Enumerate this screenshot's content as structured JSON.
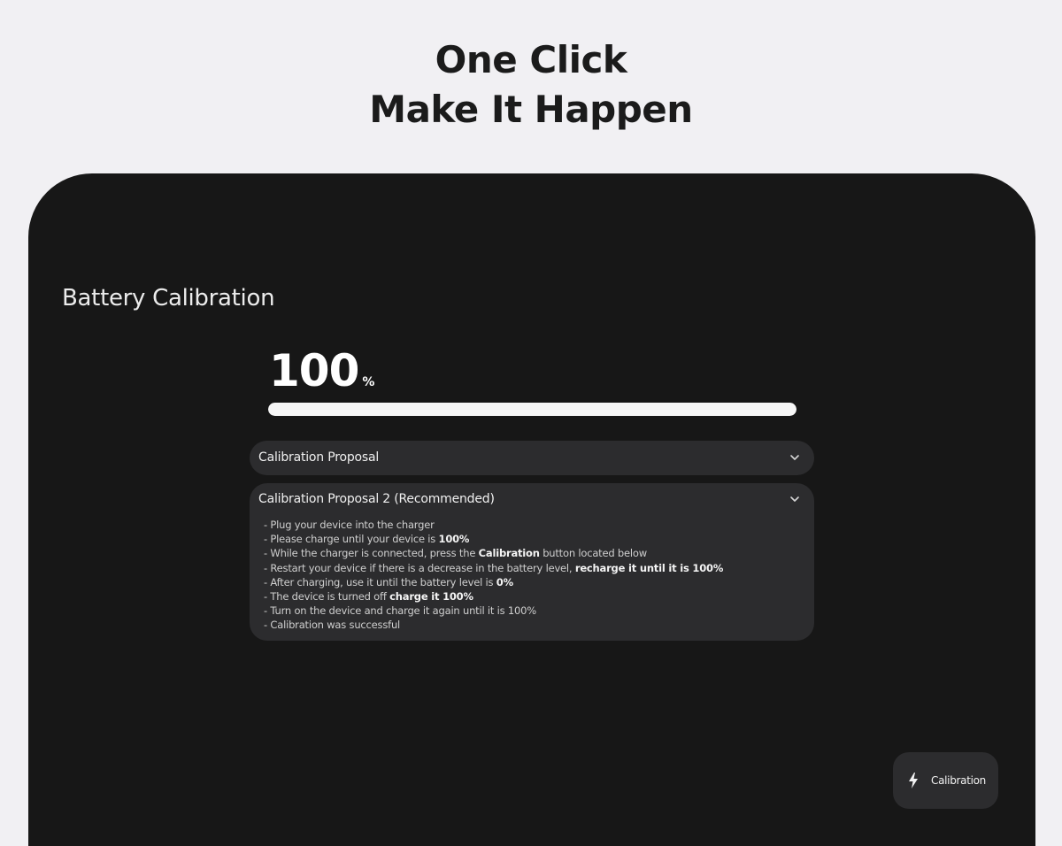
{
  "hero": {
    "line1": "One Click",
    "line2": "Make It Happen"
  },
  "app": {
    "title": "Battery Calibration"
  },
  "battery": {
    "level_value": "100",
    "level_unit": "%",
    "progress_percent": 100
  },
  "proposals": [
    {
      "title": "Calibration Proposal",
      "expanded": false
    },
    {
      "title": "Calibration Proposal 2 (Recommended)",
      "expanded": true,
      "steps": [
        {
          "prefix": "- Plug your device into the charger",
          "bold": "",
          "suffix": ""
        },
        {
          "prefix": "- Please charge until your device is ",
          "bold": "100%",
          "suffix": ""
        },
        {
          "prefix": "- While the charger is connected, press the ",
          "bold": "Calibration",
          "suffix": " button located below"
        },
        {
          "prefix": "- Restart your device if there is a decrease in the battery level, ",
          "bold": "recharge it until it is 100%",
          "suffix": ""
        },
        {
          "prefix": "- After charging, use it until the battery level is ",
          "bold": "0%",
          "suffix": ""
        },
        {
          "prefix": "- The device is turned off ",
          "bold": "charge it 100%",
          "suffix": ""
        },
        {
          "prefix": "- Turn on the device and charge it again until it is 100%",
          "bold": "",
          "suffix": ""
        },
        {
          "prefix": "- Calibration was successful",
          "bold": "",
          "suffix": ""
        }
      ]
    }
  ],
  "calibration_button": {
    "label": "Calibration",
    "icon": "lightning-bolt-icon"
  },
  "colors": {
    "background": "#f1f0f3",
    "device": "#171717",
    "card": "#2c2c2e",
    "progress": "#f7f7f7"
  }
}
